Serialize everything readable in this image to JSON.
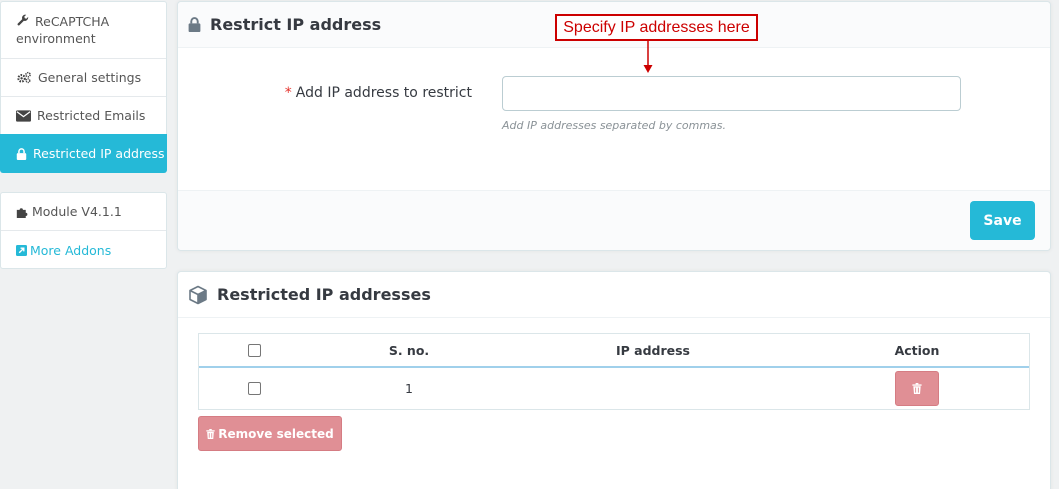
{
  "sidebar": {
    "items": [
      {
        "label": "ReCAPTCHA environment",
        "icon": "wrench-icon"
      },
      {
        "label": "General settings",
        "icon": "gears-icon"
      },
      {
        "label": "Restricted Emails",
        "icon": "envelope-icon"
      },
      {
        "label": "Restricted IP address",
        "icon": "lock-icon",
        "active": true
      }
    ],
    "extra": [
      {
        "label": "Module V4.1.1",
        "icon": "puzzle-icon"
      },
      {
        "label": "More Addons",
        "icon": "external-link-icon"
      }
    ]
  },
  "restrict_panel": {
    "title": "Restrict IP address",
    "field_required_mark": "*",
    "field_label": "Add IP address to restrict",
    "field_value": "",
    "help_text": "Add IP addresses separated by commas.",
    "save_label": "Save"
  },
  "annotation": {
    "text": "Specify IP addresses here",
    "color": "#cc0000"
  },
  "list_panel": {
    "title": "Restricted IP addresses",
    "columns": [
      "S. no.",
      "IP address",
      "Action"
    ],
    "rows": [
      {
        "sno": "1",
        "ip": "",
        "checked": false
      }
    ],
    "remove_selected_label": "Remove selected"
  },
  "colors": {
    "accent": "#25b9d7",
    "danger_light": "#e08f95",
    "background": "#eff1f2"
  }
}
